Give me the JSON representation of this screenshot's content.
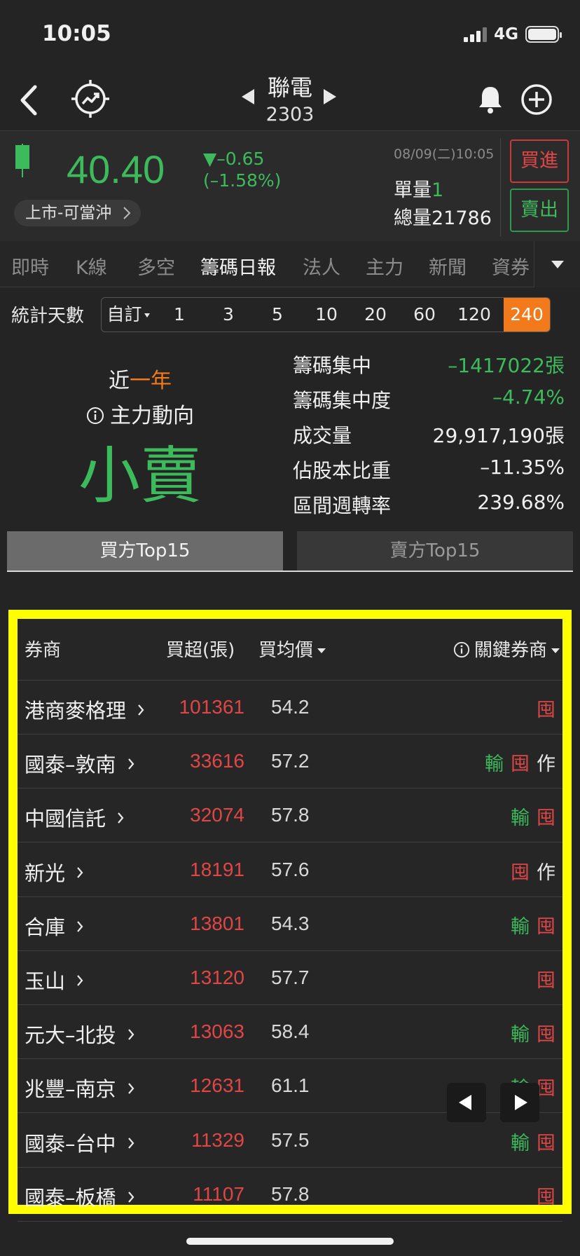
{
  "status": {
    "time": "10:05",
    "network": "4G"
  },
  "header": {
    "stock_name": "聯電",
    "stock_code": "2303"
  },
  "quote": {
    "price": "40.40",
    "change": "▼–0.65",
    "change_pct": "(–1.58%)",
    "market": "上市-可當沖",
    "timestamp": "08/09(二)10:05",
    "single_volume_label": "單量",
    "single_volume": "1",
    "total_volume_label": "總量",
    "total_volume": "21786",
    "buy_label": "買進",
    "sell_label": "賣出"
  },
  "tabs": [
    "即時",
    "K線",
    "多空",
    "籌碼日報",
    "法人",
    "主力",
    "新聞",
    "資券"
  ],
  "days": {
    "label": "統計天數",
    "custom": "自訂",
    "options": [
      "1",
      "3",
      "5",
      "10",
      "20",
      "60",
      "120",
      "240"
    ],
    "selected": "240"
  },
  "summary": {
    "period_prefix": "近",
    "period": "一年",
    "mainforce_label": "主力動向",
    "verdict": "小賣",
    "stats": [
      {
        "label": "籌碼集中",
        "value": "–1417022張"
      },
      {
        "label": "籌碼集中度",
        "value": "–4.74%"
      },
      {
        "label": "成交量",
        "value": "29,917,190張"
      },
      {
        "label": "佔股本比重",
        "value": "–11.35%"
      },
      {
        "label": "區間週轉率",
        "value": "239.68%"
      }
    ]
  },
  "side_tabs": {
    "buy": "買方Top15",
    "sell": "賣方Top15"
  },
  "table": {
    "headers": {
      "broker": "券商",
      "net_buy": "買超(張)",
      "avg_price": "買均價",
      "key_broker": "關鍵券商"
    },
    "rows": [
      {
        "broker": "港商麥格理",
        "net_buy": "101361",
        "avg_price": "54.2",
        "tags": [
          "囤"
        ]
      },
      {
        "broker": "國泰–敦南",
        "net_buy": "33616",
        "avg_price": "57.2",
        "tags": [
          "輸",
          "囤",
          "作"
        ]
      },
      {
        "broker": "中國信託",
        "net_buy": "32074",
        "avg_price": "57.8",
        "tags": [
          "輸",
          "囤"
        ]
      },
      {
        "broker": "新光",
        "net_buy": "18191",
        "avg_price": "57.6",
        "tags": [
          "囤",
          "作"
        ]
      },
      {
        "broker": "合庫",
        "net_buy": "13801",
        "avg_price": "54.3",
        "tags": [
          "輸",
          "囤"
        ]
      },
      {
        "broker": "玉山",
        "net_buy": "13120",
        "avg_price": "57.7",
        "tags": [
          "囤"
        ]
      },
      {
        "broker": "元大–北投",
        "net_buy": "13063",
        "avg_price": "58.4",
        "tags": [
          "輸",
          "囤"
        ]
      },
      {
        "broker": "兆豐–南京",
        "net_buy": "12631",
        "avg_price": "61.1",
        "tags": [
          "輸",
          "囤"
        ]
      },
      {
        "broker": "國泰–台中",
        "net_buy": "11329",
        "avg_price": "57.5",
        "tags": [
          "輸",
          "囤"
        ]
      },
      {
        "broker": "國泰–板橋",
        "net_buy": "11107",
        "avg_price": "57.8",
        "tags": [
          "囤"
        ]
      }
    ]
  },
  "colors": {
    "up": "#e14646",
    "down": "#3dbb5c",
    "accent": "#f27a1a",
    "highlight": "#ffff00"
  },
  "icons": [
    "back-icon",
    "trend-icon",
    "bell-icon",
    "plus-icon",
    "info-icon",
    "chevron-right-icon"
  ]
}
